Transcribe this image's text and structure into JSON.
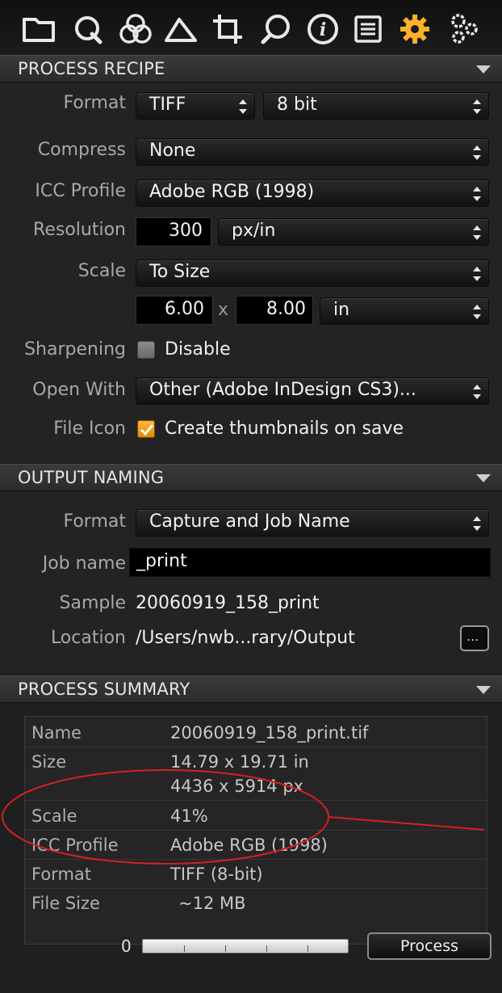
{
  "toolbar": {
    "tools": [
      {
        "icon": "folder-icon"
      },
      {
        "icon": "quick-icon"
      },
      {
        "icon": "color-icon"
      },
      {
        "icon": "exposure-icon"
      },
      {
        "icon": "crop-icon"
      },
      {
        "icon": "focus-icon"
      },
      {
        "icon": "metadata-icon"
      },
      {
        "icon": "batch-icon"
      },
      {
        "icon": "output-icon",
        "active": true
      },
      {
        "icon": "settings-icon"
      }
    ],
    "accent": "#ffb12b"
  },
  "process_recipe": {
    "title": "PROCESS RECIPE",
    "format_label": "Format",
    "format_value": "TIFF",
    "bit_depth": "8 bit",
    "compress_label": "Compress",
    "compress_value": "None",
    "icc_label": "ICC Profile",
    "icc_value": "Adobe RGB (1998)",
    "resolution_label": "Resolution",
    "resolution_value": "300",
    "resolution_unit": "px/in",
    "scale_label": "Scale",
    "scale_value": "To Size",
    "width_value": "6.00",
    "times": "x",
    "height_value": "8.00",
    "size_unit": "in",
    "sharpening_label": "Sharpening",
    "sharpening_text": "Disable",
    "sharpening_checked": false,
    "open_with_label": "Open With",
    "open_with_value": "Other (Adobe InDesign CS3)...",
    "file_icon_label": "File Icon",
    "file_icon_text": "Create thumbnails on save",
    "file_icon_checked": true
  },
  "output_naming": {
    "title": "OUTPUT NAMING",
    "format_label": "Format",
    "format_value": "Capture and Job Name",
    "job_name_label": "Job name",
    "job_name_value": "_print",
    "sample_label": "Sample",
    "sample_value": "20060919_158_print",
    "location_label": "Location",
    "location_value": "/Users/nwb...rary/Output",
    "browse_label": "..."
  },
  "process_summary": {
    "title": "PROCESS SUMMARY",
    "rows": [
      {
        "key": "Name",
        "value": "20060919_158_print.tif"
      },
      {
        "key": "Size",
        "value": "14.79 x 19.71 in",
        "value2": "4436 x 5914 px"
      },
      {
        "key": "Scale",
        "value": "41%"
      },
      {
        "key": "ICC Profile",
        "value": "Adobe RGB (1998)"
      },
      {
        "key": "Format",
        "value": "TIFF (8-bit)"
      },
      {
        "key": "File Size",
        "value": "~12 MB"
      }
    ]
  },
  "process_bar": {
    "count": "0",
    "progress": 0,
    "button_label": "Process"
  },
  "annotation_color": "#d42020"
}
